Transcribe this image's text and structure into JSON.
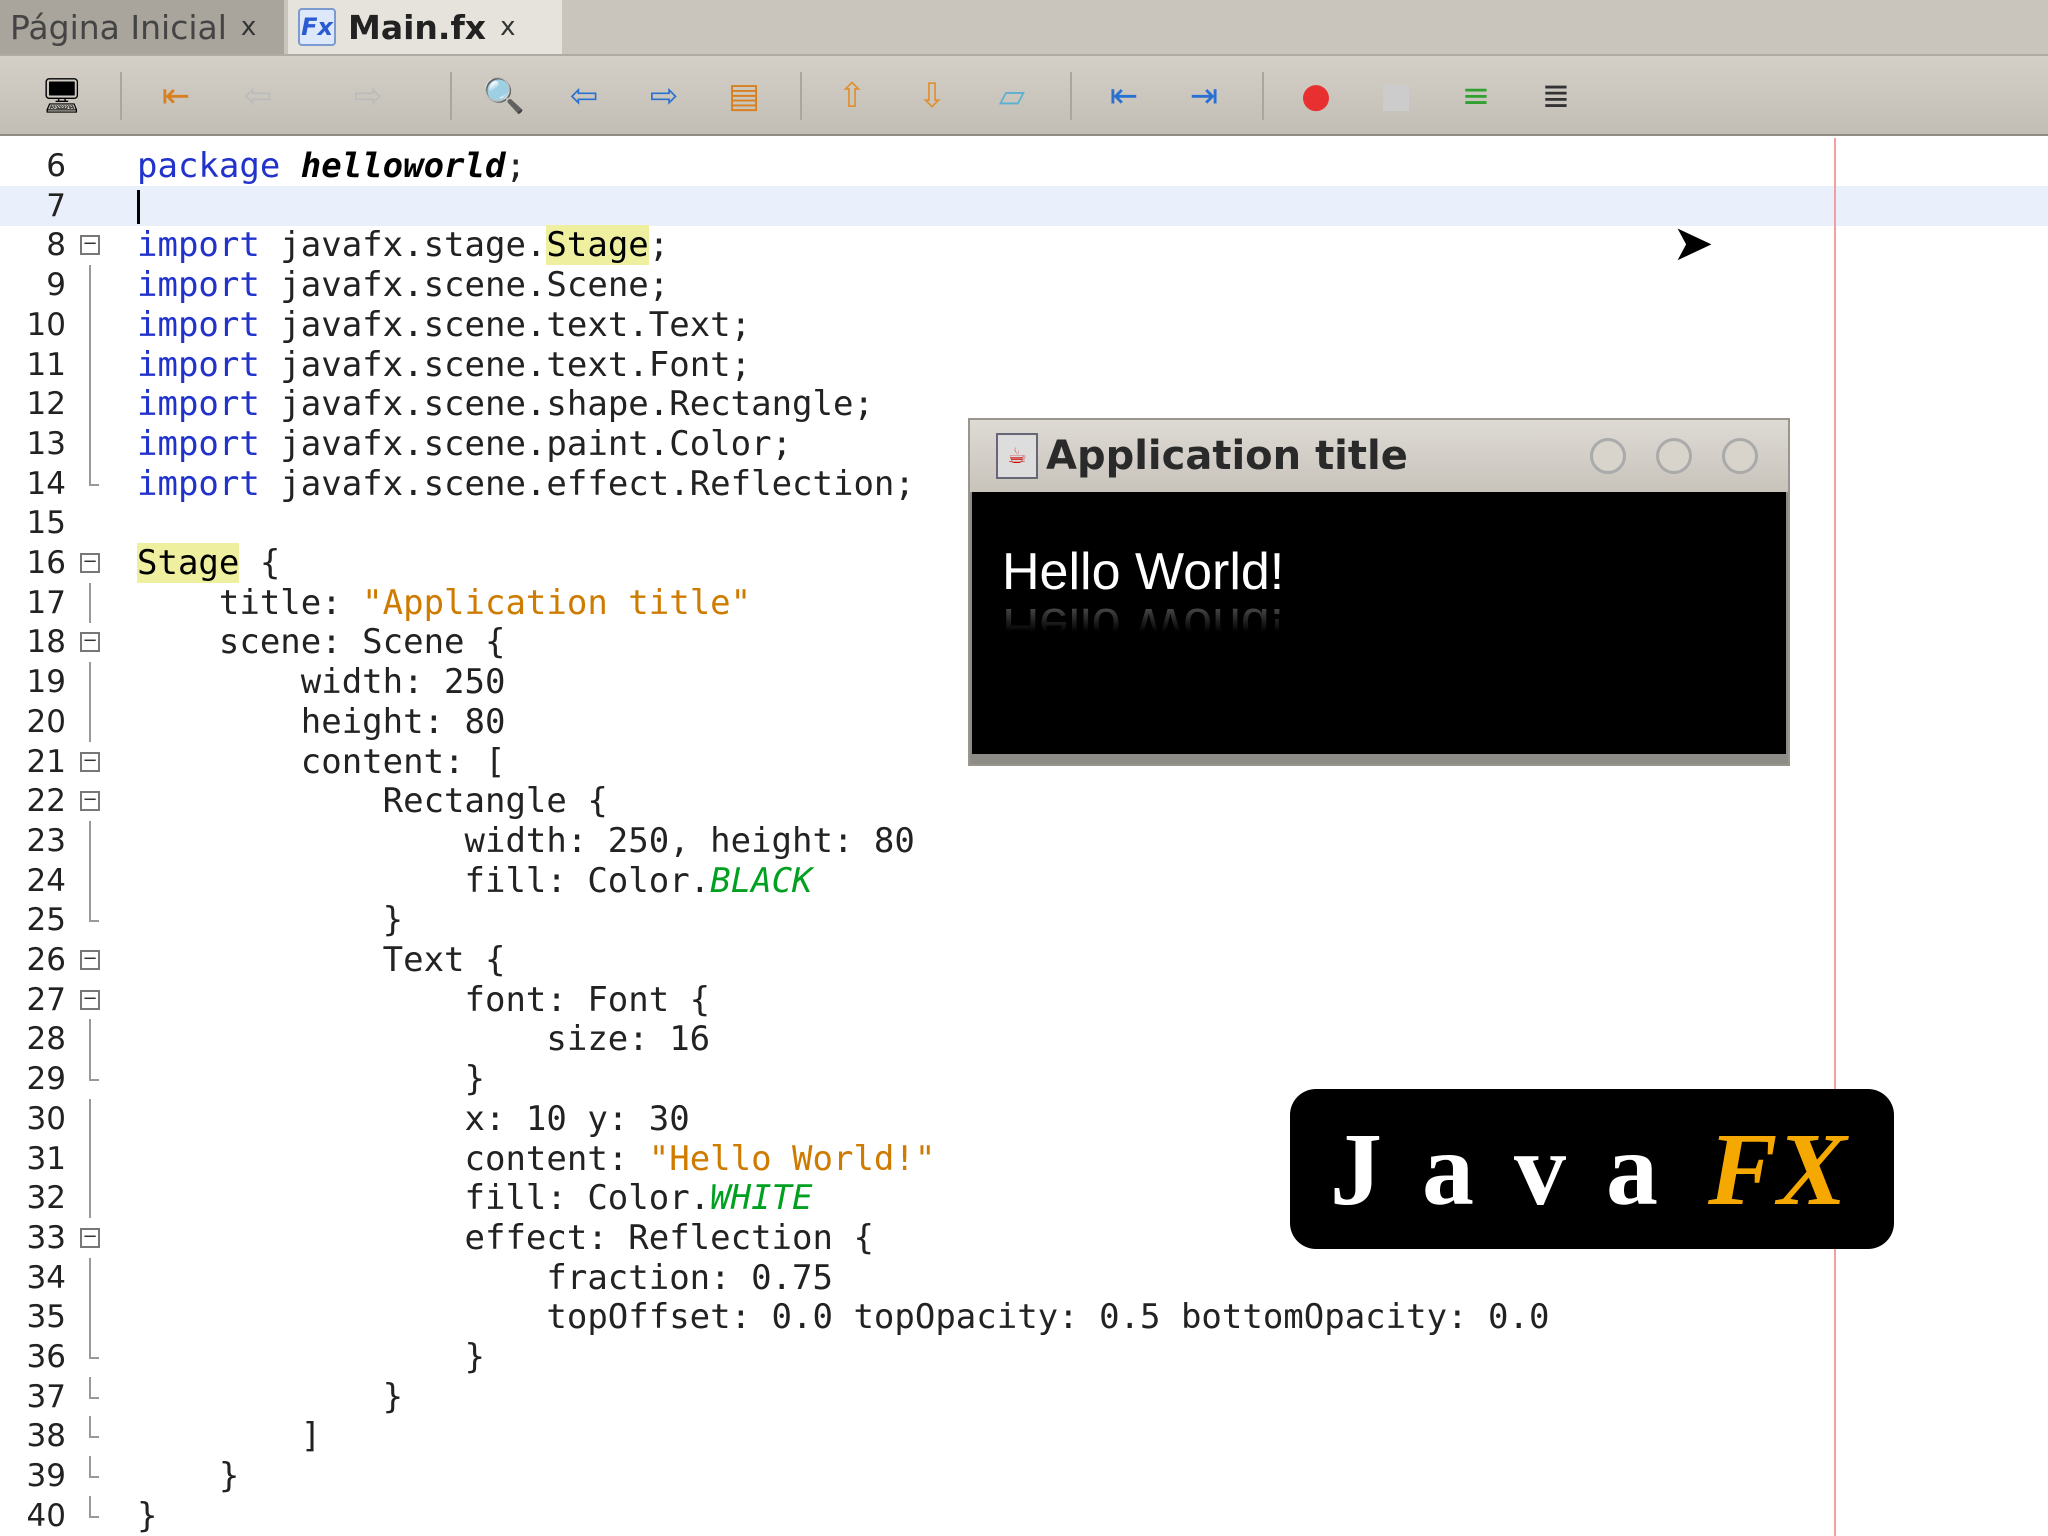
{
  "tabs": [
    {
      "label": "Página Inicial",
      "close": "x",
      "active": false
    },
    {
      "label": "Main.fx",
      "close": "x",
      "active": true,
      "icon_text": "Fx"
    }
  ],
  "toolbar": {
    "icons": [
      "navigator-eye-icon",
      "last-edit-icon",
      "back-icon",
      "forward-icon",
      "find-icon",
      "find-previous-icon",
      "find-next-icon",
      "toggle-highlight-icon",
      "previous-bookmark-icon",
      "next-bookmark-icon",
      "toggle-bookmark-icon",
      "shift-left-icon",
      "shift-right-icon",
      "record-macro-icon",
      "stop-macro-icon",
      "comment-icon",
      "uncomment-icon"
    ]
  },
  "editor": {
    "current_line": 7,
    "lines": [
      {
        "n": "6",
        "f": "",
        "seg": [
          [
            "package ",
            "k"
          ],
          [
            "helloworld",
            "b"
          ],
          [
            ";",
            "n"
          ]
        ]
      },
      {
        "n": "7",
        "f": "",
        "seg": []
      },
      {
        "n": "8",
        "f": "open",
        "seg": [
          [
            "import ",
            "k"
          ],
          [
            "javafx.stage.",
            "n"
          ],
          [
            "Stage",
            "h"
          ],
          [
            ";",
            "n"
          ]
        ]
      },
      {
        "n": "9",
        "f": "v",
        "seg": [
          [
            "import ",
            "k"
          ],
          [
            "javafx.scene.Scene;",
            "n"
          ]
        ]
      },
      {
        "n": "10",
        "f": "v",
        "seg": [
          [
            "import ",
            "k"
          ],
          [
            "javafx.scene.text.Text;",
            "n"
          ]
        ]
      },
      {
        "n": "11",
        "f": "v",
        "seg": [
          [
            "import ",
            "k"
          ],
          [
            "javafx.scene.text.Font;",
            "n"
          ]
        ]
      },
      {
        "n": "12",
        "f": "v",
        "seg": [
          [
            "import ",
            "k"
          ],
          [
            "javafx.scene.shape.Rectangle;",
            "n"
          ]
        ]
      },
      {
        "n": "13",
        "f": "v",
        "seg": [
          [
            "import ",
            "k"
          ],
          [
            "javafx.scene.paint.Color;",
            "n"
          ]
        ]
      },
      {
        "n": "14",
        "f": "end",
        "seg": [
          [
            "import ",
            "k"
          ],
          [
            "javafx.scene.effect.Reflection;",
            "n"
          ]
        ]
      },
      {
        "n": "15",
        "f": "",
        "seg": []
      },
      {
        "n": "16",
        "f": "open",
        "seg": [
          [
            "Stage",
            "h"
          ],
          [
            " {",
            "n"
          ]
        ]
      },
      {
        "n": "17",
        "f": "v",
        "seg": [
          [
            "    title: ",
            "n"
          ],
          [
            "\"Application title\"",
            "s"
          ]
        ]
      },
      {
        "n": "18",
        "f": "open",
        "seg": [
          [
            "    scene: Scene {",
            "n"
          ]
        ]
      },
      {
        "n": "19",
        "f": "v",
        "seg": [
          [
            "        width: 250",
            "n"
          ]
        ]
      },
      {
        "n": "20",
        "f": "v",
        "seg": [
          [
            "        height: 80",
            "n"
          ]
        ]
      },
      {
        "n": "21",
        "f": "open",
        "seg": [
          [
            "        content: [",
            "n"
          ]
        ]
      },
      {
        "n": "22",
        "f": "open",
        "seg": [
          [
            "            Rectangle {",
            "n"
          ]
        ]
      },
      {
        "n": "23",
        "f": "v",
        "seg": [
          [
            "                width: 250, height: 80",
            "n"
          ]
        ]
      },
      {
        "n": "24",
        "f": "v",
        "seg": [
          [
            "                fill: Color.",
            "n"
          ],
          [
            "BLACK",
            "g"
          ]
        ]
      },
      {
        "n": "25",
        "f": "end",
        "seg": [
          [
            "            }",
            "n"
          ]
        ]
      },
      {
        "n": "26",
        "f": "open",
        "seg": [
          [
            "            Text {",
            "n"
          ]
        ]
      },
      {
        "n": "27",
        "f": "open",
        "seg": [
          [
            "                font: Font {",
            "n"
          ]
        ]
      },
      {
        "n": "28",
        "f": "v",
        "seg": [
          [
            "                    size: 16",
            "n"
          ]
        ]
      },
      {
        "n": "29",
        "f": "end",
        "seg": [
          [
            "                }",
            "n"
          ]
        ]
      },
      {
        "n": "30",
        "f": "v",
        "seg": [
          [
            "                x: 10 y: 30",
            "n"
          ]
        ]
      },
      {
        "n": "31",
        "f": "v",
        "seg": [
          [
            "                content: ",
            "n"
          ],
          [
            "\"Hello World!\"",
            "s"
          ]
        ]
      },
      {
        "n": "32",
        "f": "v",
        "seg": [
          [
            "                fill: Color.",
            "n"
          ],
          [
            "WHITE",
            "g"
          ]
        ]
      },
      {
        "n": "33",
        "f": "open",
        "seg": [
          [
            "                effect: Reflection {",
            "n"
          ]
        ]
      },
      {
        "n": "34",
        "f": "v",
        "seg": [
          [
            "                    fraction: 0.75",
            "n"
          ]
        ]
      },
      {
        "n": "35",
        "f": "v",
        "seg": [
          [
            "                    topOffset: 0.0 topOpacity: 0.5 bottomOpacity: 0.0",
            "n"
          ]
        ]
      },
      {
        "n": "36",
        "f": "end",
        "seg": [
          [
            "                }",
            "n"
          ]
        ]
      },
      {
        "n": "37",
        "f": "end",
        "seg": [
          [
            "            }",
            "n"
          ]
        ]
      },
      {
        "n": "38",
        "f": "end",
        "seg": [
          [
            "        ]",
            "n"
          ]
        ]
      },
      {
        "n": "39",
        "f": "end",
        "seg": [
          [
            "    }",
            "n"
          ]
        ]
      },
      {
        "n": "40",
        "f": "end",
        "seg": [
          [
            "}",
            "n"
          ]
        ]
      }
    ]
  },
  "app_window": {
    "title": "Application title",
    "content": "Hello World!"
  },
  "logo": {
    "java": "Java",
    "fx": "FX"
  }
}
